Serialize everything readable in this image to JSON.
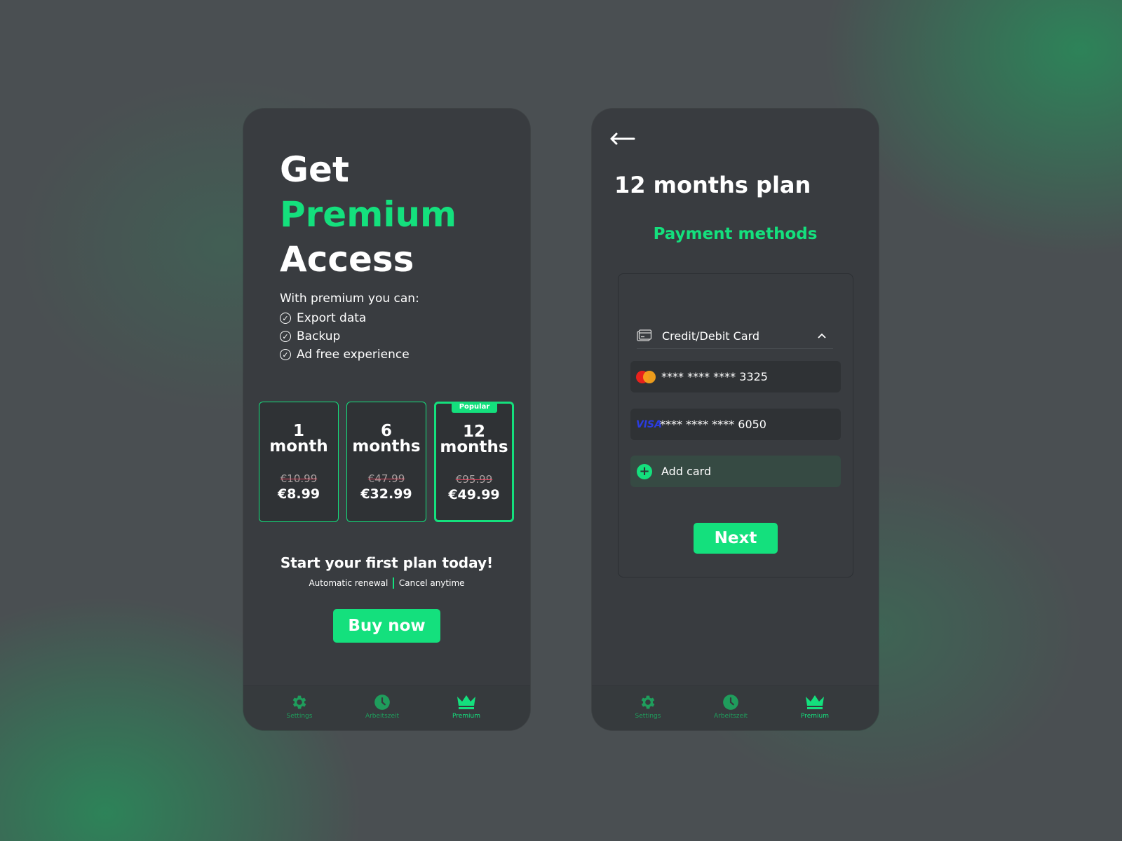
{
  "colors": {
    "accent": "#14e07d",
    "panel": "#393c40",
    "strike": "#e0435b"
  },
  "premium_screen": {
    "hero": {
      "line1": "Get",
      "line2": "Premium",
      "line3": "Access"
    },
    "intro": "With premium you can:",
    "benefits": [
      "Export data",
      "Backup",
      "Ad free experience"
    ],
    "plans": [
      {
        "duration_num": "1",
        "duration_unit": "month",
        "old_price": "€10.99",
        "price": "€8.99"
      },
      {
        "duration_num": "6",
        "duration_unit": "months",
        "old_price": "€47.99",
        "price": "€32.99"
      },
      {
        "duration_num": "12",
        "duration_unit": "months",
        "old_price": "€95.99",
        "price": "€49.99",
        "badge": "Popular",
        "selected": true
      }
    ],
    "cta_title": "Start your first plan today!",
    "cta_note_left": "Automatic renewal",
    "cta_note_right": "Cancel anytime",
    "buy_label": "Buy now"
  },
  "payment_screen": {
    "title": "12 months plan",
    "section_title": "Payment methods",
    "method_label": "Credit/Debit Card",
    "cards": [
      {
        "brand": "mastercard",
        "number": "**** **** **** 3325"
      },
      {
        "brand": "visa",
        "brand_text": "VISA",
        "number": "**** **** **** 6050"
      }
    ],
    "add_card_label": "Add card",
    "next_label": "Next"
  },
  "bottom_nav": {
    "items": [
      {
        "label": "Settings",
        "icon": "gear-icon"
      },
      {
        "label": "Arbeitszeit",
        "icon": "clock-icon"
      },
      {
        "label": "Premium",
        "icon": "crown-icon",
        "active": true
      }
    ]
  }
}
